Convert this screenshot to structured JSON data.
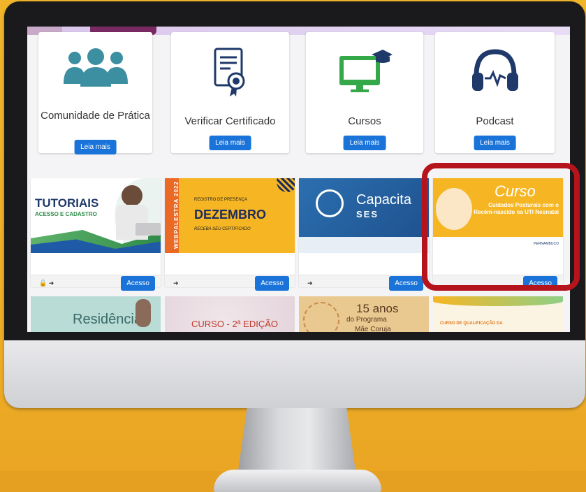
{
  "cards": [
    {
      "title": "Comunidade de Prática",
      "button": "Leia mais",
      "icon": "community-icon"
    },
    {
      "title": "Verificar Certificado",
      "button": "Leia mais",
      "icon": "certificate-icon"
    },
    {
      "title": "Cursos",
      "button": "Leia mais",
      "icon": "computer-graduation-icon"
    },
    {
      "title": "Podcast",
      "button": "Leia mais",
      "icon": "headphones-icon"
    }
  ],
  "tiles": [
    {
      "banner_title": "TUTORIAIS",
      "banner_sub": "ACESSO E CADASTRO",
      "button": "Acesso"
    },
    {
      "banner_top": "REGISTRO DE PRESENÇA",
      "banner_title": "DEZEMBRO",
      "banner_sub": "RECEBA SEU CERTIFICADO",
      "banner_side": "WEBPALESTRA",
      "banner_year": "2022",
      "button": "Acesso"
    },
    {
      "banner_title": "Capacita",
      "banner_sub": "SES",
      "button": "Acesso"
    },
    {
      "banner_title": "Curso",
      "banner_sub": "Cuidados Posturais com o Recém-nascido na UTI Neonatal",
      "logo_text": "PERNAMBUCO",
      "button": "Acesso"
    }
  ],
  "row3": [
    {
      "text": "Residência"
    },
    {
      "text": "CURSO - 2ª EDIÇÃO"
    },
    {
      "text_big": "15 anos",
      "text_small": "do Programa",
      "text_cut": "Mãe Coruja"
    },
    {
      "text": "CURSO DE QUALIFICAÇÃO DA"
    }
  ],
  "colors": {
    "accent": "#1a73d9",
    "highlight": "#b5141c",
    "icon_teal": "#3b8fa0",
    "icon_navy": "#1f3a6a",
    "icon_green": "#35a84a"
  }
}
